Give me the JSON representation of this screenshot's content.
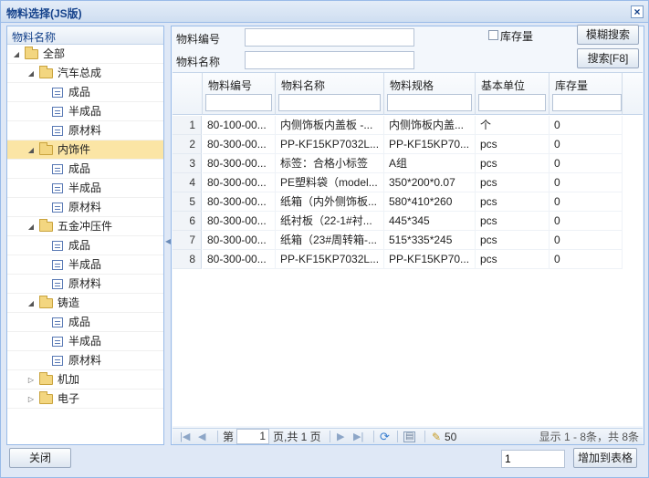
{
  "window": {
    "title": "物料选择(JS版)",
    "close_glyph": "×"
  },
  "tree": {
    "header": "物料名称",
    "items": [
      {
        "label": "全部",
        "type": "folder",
        "level": 0,
        "expanded": true
      },
      {
        "label": "汽车总成",
        "type": "folder",
        "level": 1,
        "expanded": true
      },
      {
        "label": "成品",
        "type": "leaf",
        "level": 2
      },
      {
        "label": "半成品",
        "type": "leaf",
        "level": 2
      },
      {
        "label": "原材料",
        "type": "leaf",
        "level": 2
      },
      {
        "label": "内饰件",
        "type": "folder",
        "level": 1,
        "expanded": true,
        "selected": true
      },
      {
        "label": "成品",
        "type": "leaf",
        "level": 2
      },
      {
        "label": "半成品",
        "type": "leaf",
        "level": 2
      },
      {
        "label": "原材料",
        "type": "leaf",
        "level": 2
      },
      {
        "label": "五金冲压件",
        "type": "folder",
        "level": 1,
        "expanded": true
      },
      {
        "label": "成品",
        "type": "leaf",
        "level": 2
      },
      {
        "label": "半成品",
        "type": "leaf",
        "level": 2
      },
      {
        "label": "原材料",
        "type": "leaf",
        "level": 2
      },
      {
        "label": "铸造",
        "type": "folder",
        "level": 1,
        "expanded": true
      },
      {
        "label": "成品",
        "type": "leaf",
        "level": 2
      },
      {
        "label": "半成品",
        "type": "leaf",
        "level": 2
      },
      {
        "label": "原材料",
        "type": "leaf",
        "level": 2
      },
      {
        "label": "机加",
        "type": "folder",
        "level": 1,
        "expanded": false
      },
      {
        "label": "电子",
        "type": "folder",
        "level": 1,
        "expanded": false
      }
    ]
  },
  "search": {
    "code_label": "物料编号",
    "code_value": "",
    "name_label": "物料名称",
    "name_value": "",
    "stock_label": "库存量",
    "stock_checked": false,
    "fuzzy_button": "模糊搜索",
    "search_button": "搜索[F8]"
  },
  "grid": {
    "columns": [
      "物料编号",
      "物料名称",
      "物料规格",
      "基本单位",
      "库存量"
    ],
    "rows": [
      [
        "80-100-00...",
        "内侧饰板内盖板 -...",
        "内侧饰板内盖...",
        "个",
        "0"
      ],
      [
        "80-300-00...",
        "PP-KF15KP7032L...",
        "PP-KF15KP70...",
        "pcs",
        "0"
      ],
      [
        "80-300-00...",
        "标签：合格小标签",
        "A组",
        "pcs",
        "0"
      ],
      [
        "80-300-00...",
        "PE塑料袋（model...",
        "350*200*0.07",
        "pcs",
        "0"
      ],
      [
        "80-300-00...",
        "纸箱（内外侧饰板...",
        "580*410*260",
        "pcs",
        "0"
      ],
      [
        "80-300-00...",
        "纸衬板（22-1#衬...",
        "445*345",
        "pcs",
        "0"
      ],
      [
        "80-300-00...",
        "纸箱（23#周转箱-...",
        "515*335*245",
        "pcs",
        "0"
      ],
      [
        "80-300-00...",
        "PP-KF15KP7032L...",
        "PP-KF15KP70...",
        "pcs",
        "0"
      ]
    ]
  },
  "pager": {
    "page_prefix": "第",
    "page_value": "1",
    "page_suffix": "页,共 1 页",
    "page_size": "50",
    "summary": "显示 1 - 8条，共 8条"
  },
  "footer": {
    "close_button": "关闭",
    "quantity_value": "1",
    "add_button": "增加到表格"
  }
}
